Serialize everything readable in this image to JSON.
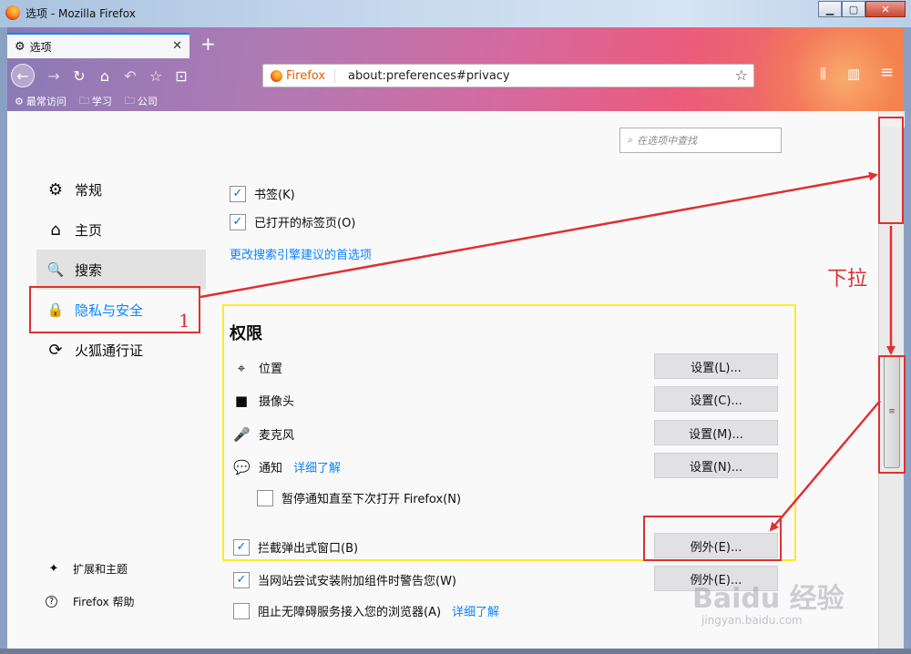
{
  "window": {
    "title": "选项 - Mozilla Firefox",
    "minimize": "▁",
    "maximize": "▢",
    "close": "✕"
  },
  "tab": {
    "label": "选项",
    "icon": "gear-icon",
    "close": "✕",
    "new_tab": "+"
  },
  "toolbar": {
    "back": "←",
    "forward": "→",
    "reload": "↻",
    "home": "⌂",
    "undo": "↶",
    "pocket": "☆",
    "screenshot": "⊡",
    "identity_brand": "Firefox",
    "url": "about:preferences#privacy",
    "bookmark_star": "☆",
    "library": "⫼",
    "sidebar": "▥",
    "menu": "≡"
  },
  "bookmarks": [
    {
      "icon": "gear-icon",
      "label": "最常访问"
    },
    {
      "icon": "folder-icon",
      "label": "学习"
    },
    {
      "icon": "folder-icon",
      "label": "公司"
    }
  ],
  "search": {
    "placeholder": "在选项中查找",
    "icon": "⌕"
  },
  "categories": [
    {
      "icon": "⚙",
      "label": "常规"
    },
    {
      "icon": "⌂",
      "label": "主页"
    },
    {
      "icon": "🔍",
      "label": "搜索"
    },
    {
      "icon": "🔒",
      "label": "隐私与安全"
    },
    {
      "icon": "⟳",
      "label": "火狐通行证"
    }
  ],
  "footer": [
    {
      "icon": "✦",
      "label": "扩展和主题"
    },
    {
      "icon": "?",
      "label": "Firefox 帮助"
    }
  ],
  "search_suggestions": {
    "bookmarks": {
      "label": "书签(K)",
      "checked": true
    },
    "open_tabs": {
      "label": "已打开的标签页(O)",
      "checked": true
    },
    "change_link": "更改搜索引擎建议的首选项"
  },
  "permissions": {
    "heading": "权限",
    "location": {
      "icon": "⌖",
      "label": "位置",
      "button": "设置(L)..."
    },
    "camera": {
      "icon": "■",
      "label": "摄像头",
      "button": "设置(C)..."
    },
    "microphone": {
      "icon": "🎤",
      "label": "麦克风",
      "button": "设置(M)..."
    },
    "notifications": {
      "icon": "💬",
      "label": "通知",
      "learn_more": "详细了解",
      "button": "设置(N)..."
    },
    "pause_notifications": {
      "label": "暂停通知直至下次打开 Firefox(N)",
      "checked": false
    },
    "block_popups": {
      "label": "拦截弹出式窗口(B)",
      "checked": true,
      "button": "例外(E)..."
    },
    "warn_addons": {
      "label": "当网站尝试安装附加组件时警告您(W)",
      "checked": true,
      "button": "例外(E)..."
    },
    "prevent_a11y": {
      "label": "阻止无障碍服务接入您的浏览器(A)",
      "checked": false,
      "learn_more": "详细了解"
    }
  },
  "checkmark": "✓",
  "scrollbar": {
    "grip": "≡"
  },
  "annotations": {
    "step_number": "1",
    "scroll_hint": "下拉",
    "accent": "#e03030",
    "highlight": "#ffea2a"
  },
  "watermark": {
    "text": "Baidu 经验",
    "sub": "jingyan.baidu.com"
  }
}
